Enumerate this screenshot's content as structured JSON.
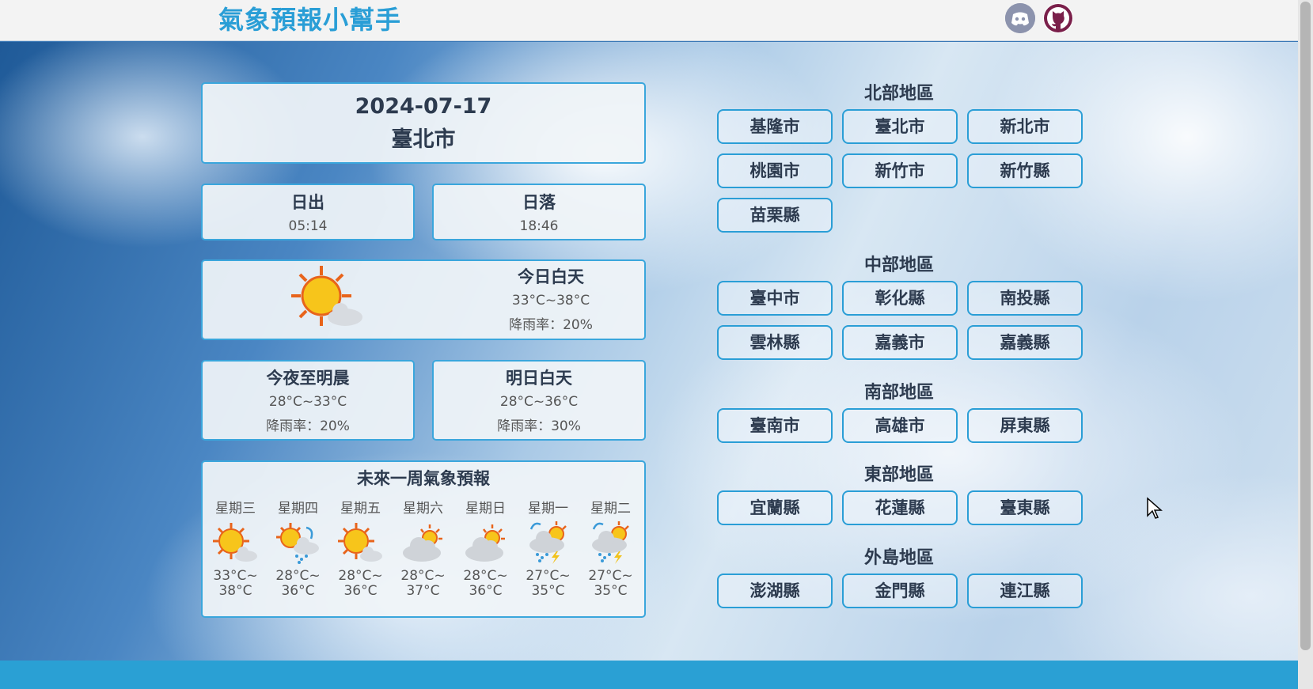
{
  "header": {
    "brand": "氣象預報小幫手",
    "icons": [
      "discord-icon",
      "github-icon"
    ]
  },
  "summary": {
    "date": "2024-07-17",
    "city": "臺北市"
  },
  "sun": {
    "sunrise_label": "日出",
    "sunrise_time": "05:14",
    "sunset_label": "日落",
    "sunset_time": "18:46"
  },
  "today": {
    "label": "今日白天",
    "temp": "33°C~38°C",
    "rain": "降雨率：20%",
    "icon": "sunny-icon"
  },
  "tonight": {
    "label": "今夜至明晨",
    "temp": "28°C~33°C",
    "rain": "降雨率：20%"
  },
  "tomorrow": {
    "label": "明日白天",
    "temp": "28°C~36°C",
    "rain": "降雨率：30%"
  },
  "week": {
    "title": "未來一周氣象預報",
    "days": [
      {
        "name": "星期三",
        "low": "33°C~",
        "high": "38°C",
        "icon": "sunny"
      },
      {
        "name": "星期四",
        "low": "28°C~",
        "high": "36°C",
        "icon": "sun-rain"
      },
      {
        "name": "星期五",
        "low": "28°C~",
        "high": "36°C",
        "icon": "sunny"
      },
      {
        "name": "星期六",
        "low": "28°C~",
        "high": "37°C",
        "icon": "cloudy-sun"
      },
      {
        "name": "星期日",
        "low": "28°C~",
        "high": "36°C",
        "icon": "cloudy-sun"
      },
      {
        "name": "星期一",
        "low": "27°C~",
        "high": "35°C",
        "icon": "thunder-rain"
      },
      {
        "name": "星期二",
        "low": "27°C~",
        "high": "35°C",
        "icon": "thunder-rain"
      }
    ]
  },
  "regions": {
    "north": {
      "title": "北部地區",
      "cities": [
        "基隆市",
        "臺北市",
        "新北市",
        "桃園市",
        "新竹市",
        "新竹縣",
        "苗栗縣"
      ]
    },
    "central": {
      "title": "中部地區",
      "cities": [
        "臺中市",
        "彰化縣",
        "南投縣",
        "雲林縣",
        "嘉義市",
        "嘉義縣"
      ]
    },
    "south": {
      "title": "南部地區",
      "cities": [
        "臺南市",
        "高雄市",
        "屏東縣"
      ]
    },
    "east": {
      "title": "東部地區",
      "cities": [
        "宜蘭縣",
        "花蓮縣",
        "臺東縣"
      ]
    },
    "islands": {
      "title": "外島地區",
      "cities": [
        "澎湖縣",
        "金門縣",
        "連江縣"
      ]
    }
  },
  "colors": {
    "accent": "#2a9ed6",
    "footer": "#2aa0d4",
    "title_text": "#2d3b4f"
  }
}
